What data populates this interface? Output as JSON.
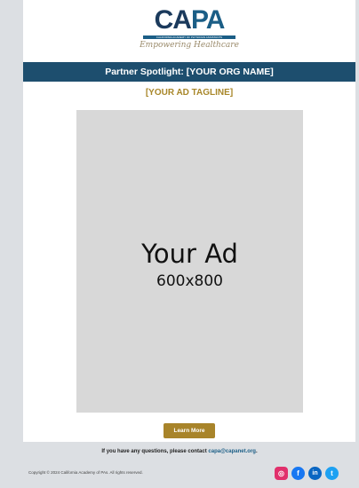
{
  "logo": {
    "word_ca": "CA",
    "word_pa": "PA",
    "subtitle_bar": "CALIFORNIA ACADEMY OF PHYSICIAN ASSISTANTS",
    "script": "Empowering Healthcare"
  },
  "banner": {
    "title": "Partner Spotlight: [YOUR ORG NAME]"
  },
  "tagline": "[YOUR AD TAGLINE]",
  "ad": {
    "title": "Your Ad",
    "size": "600x800"
  },
  "button": {
    "label": "Learn More"
  },
  "footer": {
    "questions_text": "If you have any questions, please contact ",
    "contact_email": "capa@capanet.org",
    "trailing": ".",
    "copyright": "Copyright © 2024 California Academy of PAs. All rights reserved."
  },
  "social": {
    "instagram": "◎",
    "facebook": "f",
    "linkedin": "in",
    "twitter": "t"
  },
  "colors": {
    "banner": "#1d4e6e",
    "gold": "#a8842a",
    "background": "#dcdfe3"
  }
}
